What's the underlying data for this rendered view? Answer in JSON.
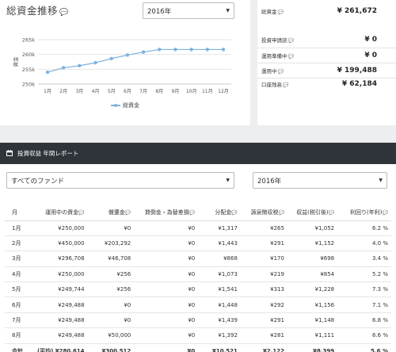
{
  "header": {
    "title": "総資金推移"
  },
  "year_select": {
    "value": "2016年"
  },
  "chart_data": {
    "type": "line",
    "categories": [
      "1月",
      "2月",
      "3月",
      "4月",
      "5月",
      "6月",
      "7月",
      "8月",
      "9月",
      "10月",
      "11月",
      "12月"
    ],
    "series": [
      {
        "name": "総資金",
        "values": [
          254000,
          255500,
          256200,
          257200,
          258600,
          259800,
          260800,
          261672,
          261672,
          261672,
          261672,
          261672
        ]
      }
    ],
    "ylim": [
      250000,
      265000
    ],
    "yticks": [
      250000,
      255000,
      260000,
      265000
    ],
    "ytick_labels": [
      "250k",
      "255k",
      "260k",
      "265k"
    ],
    "ylabel": "資金",
    "xlabel": "",
    "grid": true,
    "legend_position": "bottom",
    "color": "#7fb2dd"
  },
  "summary": {
    "total": {
      "label": "総資金",
      "value": "¥ 261,672"
    },
    "pending": {
      "label": "投資申請読",
      "value": "¥ 0"
    },
    "prep": {
      "label": "運用準備中",
      "value": "¥ 0"
    },
    "active": {
      "label": "運用中",
      "value": "¥ 199,488"
    },
    "balance": {
      "label": "口座残高",
      "value": "¥ 62,184"
    }
  },
  "report": {
    "title": "投資収益 年間レポート",
    "fund_select": "すべてのファンド",
    "year_select": "2016年",
    "columns": [
      "月",
      "運用中の資金",
      "償還金",
      "貸倒金・為替差損",
      "分配金",
      "源泉徴収税",
      "収益(税引後)",
      "利回り(年利)"
    ],
    "rows": [
      [
        "1月",
        "¥250,000",
        "¥0",
        "¥0",
        "¥1,317",
        "¥265",
        "¥1,052",
        "6.2 %"
      ],
      [
        "2月",
        "¥450,000",
        "¥203,292",
        "¥0",
        "¥1,443",
        "¥291",
        "¥1,152",
        "4.0 %"
      ],
      [
        "3月",
        "¥296,708",
        "¥46,708",
        "¥0",
        "¥868",
        "¥170",
        "¥698",
        "3.4 %"
      ],
      [
        "4月",
        "¥250,000",
        "¥256",
        "¥0",
        "¥1,073",
        "¥219",
        "¥854",
        "5.2 %"
      ],
      [
        "5月",
        "¥249,744",
        "¥256",
        "¥0",
        "¥1,541",
        "¥313",
        "¥1,228",
        "7.3 %"
      ],
      [
        "6月",
        "¥249,488",
        "¥0",
        "¥0",
        "¥1,448",
        "¥292",
        "¥1,156",
        "7.1 %"
      ],
      [
        "7月",
        "¥249,488",
        "¥0",
        "¥0",
        "¥1,439",
        "¥291",
        "¥1,148",
        "6.8 %"
      ],
      [
        "8月",
        "¥249,488",
        "¥50,000",
        "¥0",
        "¥1,392",
        "¥281",
        "¥1,111",
        "6.6 %"
      ]
    ],
    "total": [
      "合計",
      "(平均) ¥280,614",
      "¥300,512",
      "¥0",
      "¥10,521",
      "¥2,122",
      "¥8,399",
      "5.6 %"
    ]
  },
  "icons": {
    "chat": "chat-bubble-icon",
    "calendar": "calendar-icon",
    "caret": "caret-down-icon"
  }
}
